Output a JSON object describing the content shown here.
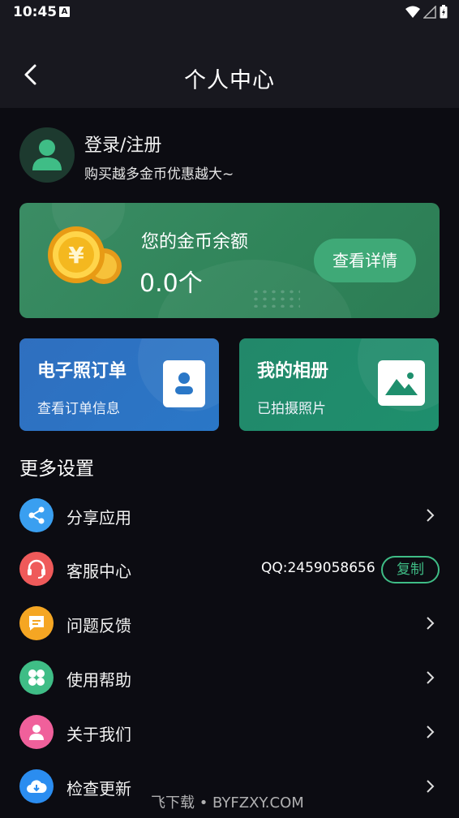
{
  "status_bar": {
    "time": "10:45",
    "notification_badge": "A",
    "icons": [
      "wifi-icon",
      "signal-icon",
      "battery-icon"
    ]
  },
  "header": {
    "title": "个人中心",
    "back_icon": "back-arrow-icon"
  },
  "profile": {
    "login_label": "登录/注册",
    "promo_text": "购买越多金币优惠越大~",
    "avatar_icon": "user-avatar-icon"
  },
  "balance_card": {
    "label": "您的金币余额",
    "value": "0.0个",
    "detail_button": "查看详情",
    "coin_icon": "coin-icon",
    "coin_symbol": "¥",
    "color": "#2f8459"
  },
  "tiles": {
    "orders": {
      "title": "电子照订单",
      "subtitle": "查看订单信息",
      "icon": "id-photo-icon",
      "color": "#2a77c7"
    },
    "album": {
      "title": "我的相册",
      "subtitle": "已拍摄照片",
      "icon": "image-icon",
      "color": "#1e8f6d"
    }
  },
  "more_settings": {
    "title": "更多设置",
    "items": [
      {
        "label": "分享应用",
        "icon": "share-icon",
        "icon_color": "#3a9ff0"
      },
      {
        "label": "客服中心",
        "icon": "headset-icon",
        "icon_color": "#ef5a5a",
        "qq": "QQ:2459058656",
        "copy_label": "复制"
      },
      {
        "label": "问题反馈",
        "icon": "feedback-icon",
        "icon_color": "#f5a623"
      },
      {
        "label": "使用帮助",
        "icon": "help-grid-icon",
        "icon_color": "#3fbd86"
      },
      {
        "label": "关于我们",
        "icon": "person-icon",
        "icon_color": "#f0609b"
      },
      {
        "label": "检查更新",
        "icon": "cloud-download-icon",
        "icon_color": "#2b8df0"
      }
    ]
  },
  "watermark": "飞下载 • BYFZXY.COM",
  "accent_color": "#3fbd86"
}
